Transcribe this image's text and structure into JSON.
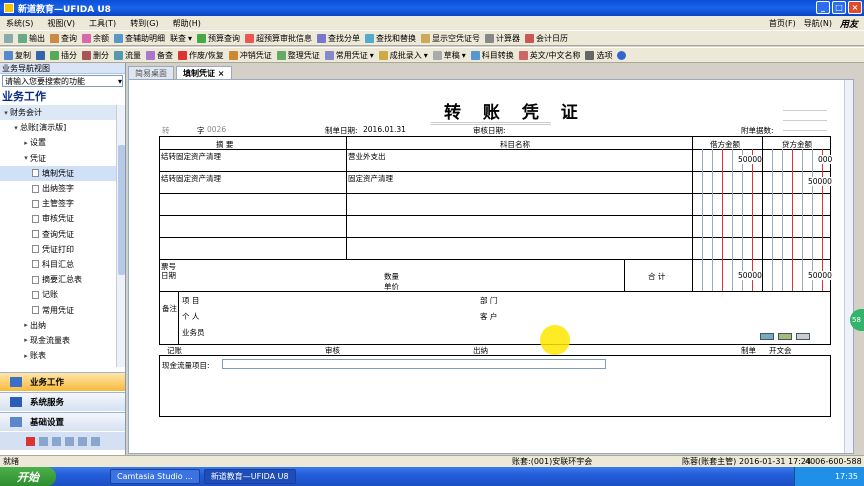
{
  "window": {
    "title": "新道教育—UFIDA U8"
  },
  "menu": {
    "items": [
      "系统(S)",
      "视图(V)",
      "工具(T)",
      "转到(G)",
      "帮助(H)"
    ],
    "home": "首页(F)",
    "nav": "导航(N)",
    "brand": "用友"
  },
  "toolbar1": [
    "输出",
    "查询",
    "余额",
    "查辅助明细",
    "联查",
    "预算查询",
    "超预算审批信息",
    "查找分单",
    "查找和替换",
    "显示空凭证号",
    "计算器",
    "会计日历"
  ],
  "toolbar2": [
    "复制",
    "插分",
    "删分",
    "流量",
    "备查",
    "作废/恢复",
    "冲销凭证",
    "整理凭证",
    "常用凭证",
    "成批录入",
    "草稿",
    "科目转换",
    "英文/中文名称",
    "选项"
  ],
  "left": {
    "header": "业务导航视图",
    "search": "请输入您要搜索的功能",
    "title": "业务工作",
    "tree": [
      {
        "label": "财务会计",
        "level": 0,
        "arrow": "▾"
      },
      {
        "label": "总账[演示版]",
        "level": 1,
        "arrow": "▾"
      },
      {
        "label": "设置",
        "level": 2,
        "arrow": "▸"
      },
      {
        "label": "凭证",
        "level": 2,
        "arrow": "▾"
      },
      {
        "label": "填制凭证",
        "level": 3,
        "sel": true
      },
      {
        "label": "出纳签字",
        "level": 3
      },
      {
        "label": "主管签字",
        "level": 3
      },
      {
        "label": "审核凭证",
        "level": 3
      },
      {
        "label": "查询凭证",
        "level": 3
      },
      {
        "label": "凭证打印",
        "level": 3
      },
      {
        "label": "科目汇总",
        "level": 3
      },
      {
        "label": "摘要汇总表",
        "level": 3
      },
      {
        "label": "记账",
        "level": 3
      },
      {
        "label": "常用凭证",
        "level": 3
      },
      {
        "label": "出纳",
        "level": 2,
        "arrow": "▸"
      },
      {
        "label": "现金流量表",
        "level": 2,
        "arrow": "▸"
      },
      {
        "label": "账表",
        "level": 2,
        "arrow": "▸"
      }
    ],
    "nav": [
      "业务工作",
      "系统服务",
      "基础设置"
    ]
  },
  "tabs": [
    "简易桌面",
    "填制凭证"
  ],
  "voucher": {
    "title": "转 账 凭 证",
    "zi": "转",
    "zi_label": "字",
    "no": "0026",
    "date_label": "制单日期:",
    "date": "2016.01.31",
    "audit_label": "审核日期:",
    "attach_label": "附单据数:",
    "col_summary": "摘 要",
    "col_account": "科目名称",
    "col_debit": "借方金额",
    "col_credit": "贷方金额",
    "rows": [
      {
        "summary": "结转固定资产清理",
        "account": "营业外支出",
        "debit": "50000",
        "credit": "000"
      },
      {
        "summary": "结转固定资产清理",
        "account": "固定资产清理",
        "debit": "",
        "credit": "50000"
      },
      {
        "summary": "",
        "account": "",
        "debit": "",
        "credit": ""
      },
      {
        "summary": "",
        "account": "",
        "debit": "",
        "credit": ""
      },
      {
        "summary": "",
        "account": "",
        "debit": "",
        "credit": ""
      }
    ],
    "bill_no": "票号",
    "bill_date": "日期",
    "qty": "数量",
    "price": "单价",
    "total": "合 计",
    "total_debit": "50000",
    "total_credit": "50000",
    "note": "备注",
    "project": "项 目",
    "dept": "部 门",
    "person": "个 人",
    "customer": "客 户",
    "salesman": "业务员",
    "footer": [
      "记账",
      "审核",
      "出纳",
      "制单",
      "开文会"
    ],
    "cash_label": "现金流量项目:"
  },
  "status": {
    "left": "就绪",
    "account": "账套:(001)安联环宇会",
    "user": "陈蓉(账套主管)",
    "date": "2016-01-31 17:24",
    "phone": "4006-600-588"
  },
  "taskbar": {
    "start": "开始",
    "tasks": [
      "Camtasia Studio ...",
      "新道教育—UFIDA U8"
    ],
    "time": "17:35"
  },
  "badge": "58"
}
